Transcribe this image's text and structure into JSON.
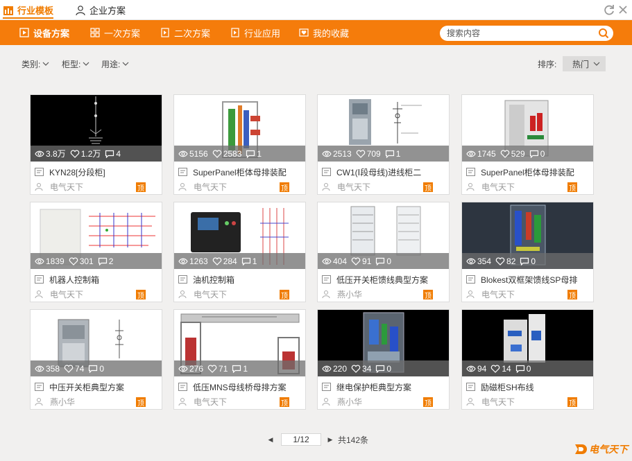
{
  "window": {
    "tabs": [
      {
        "label": "行业模板",
        "active": true
      },
      {
        "label": "企业方案",
        "active": false
      }
    ]
  },
  "nav": {
    "items": [
      {
        "label": "设备方案",
        "active": true
      },
      {
        "label": "一次方案",
        "active": false
      },
      {
        "label": "二次方案",
        "active": false
      },
      {
        "label": "行业应用",
        "active": false
      },
      {
        "label": "我的收藏",
        "active": false
      }
    ],
    "search_placeholder": "搜索内容"
  },
  "filters": {
    "category": "类别:",
    "cabinet": "柜型:",
    "usage": "用途:",
    "sort_label": "排序:",
    "sort_value": "热门"
  },
  "cards": [
    {
      "views": "3.8万",
      "likes": "1.2万",
      "comments": "4",
      "title": "KYN28[分段柜]",
      "author": "电气天下",
      "badge": "顶"
    },
    {
      "views": "5156",
      "likes": "2583",
      "comments": "1",
      "title": "SuperPanel柜体母排装配",
      "author": "电气天下",
      "badge": "顶"
    },
    {
      "views": "2513",
      "likes": "709",
      "comments": "1",
      "title": "CW1(Ⅰ段母线)进线柜二",
      "author": "电气天下",
      "badge": "顶"
    },
    {
      "views": "1745",
      "likes": "529",
      "comments": "0",
      "title": "SuperPanel柜体母排装配",
      "author": "电气天下",
      "badge": "顶"
    },
    {
      "views": "1839",
      "likes": "301",
      "comments": "2",
      "title": "机器人控制箱",
      "author": "电气天下",
      "badge": "顶"
    },
    {
      "views": "1263",
      "likes": "284",
      "comments": "1",
      "title": "油机控制箱",
      "author": "电气天下",
      "badge": "顶"
    },
    {
      "views": "404",
      "likes": "91",
      "comments": "0",
      "title": "低压开关柜馈线典型方案",
      "author": "燕小华",
      "badge": "顶"
    },
    {
      "views": "354",
      "likes": "82",
      "comments": "0",
      "title": "Blokest双框架馈线SP母排",
      "author": "电气天下",
      "badge": "顶"
    },
    {
      "views": "358",
      "likes": "74",
      "comments": "0",
      "title": "中压开关柜典型方案",
      "author": "燕小华",
      "badge": "顶"
    },
    {
      "views": "276",
      "likes": "71",
      "comments": "1",
      "title": "低压MNS母线桥母排方案",
      "author": "电气天下",
      "badge": "顶"
    },
    {
      "views": "220",
      "likes": "34",
      "comments": "0",
      "title": "继电保护柜典型方案",
      "author": "燕小华",
      "badge": "顶"
    },
    {
      "views": "94",
      "likes": "14",
      "comments": "0",
      "title": "励磁柜SH布线",
      "author": "电气天下",
      "badge": "顶"
    }
  ],
  "pager": {
    "page_value": "1/12",
    "total": "共142条"
  },
  "brand": {
    "name": "电气天下"
  },
  "colors": {
    "accent": "#f57c0b",
    "badge": "#f07c00"
  }
}
